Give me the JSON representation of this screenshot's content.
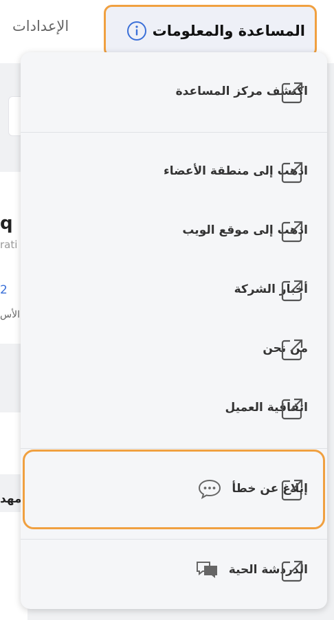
{
  "header": {
    "help_tab_label": "المساعدة والمعلومات",
    "settings_tab_label": "الإعدادات"
  },
  "background": {
    "frag_q": "q",
    "frag_rati": "rati",
    "frag_2": "2",
    "frag_al": "الأس",
    "frag_mh": "مهد"
  },
  "menu": {
    "items": [
      {
        "label": "اكتشف مركز المساعدة",
        "icon": "external-link-icon"
      },
      {
        "label": "اذهب إلى منطقة الأعضاء",
        "icon": "external-link-icon"
      },
      {
        "label": "اذهب إلى موقع الويب",
        "icon": "external-link-icon"
      },
      {
        "label": "أخبار الشركة",
        "icon": "external-link-icon"
      },
      {
        "label": "من نحن",
        "icon": "external-link-icon"
      },
      {
        "label": "اتفاقية العميل",
        "icon": "external-link-icon"
      },
      {
        "label": "إبلاغ عن خطأ",
        "icon": "external-link-icon",
        "lead_icon": "chat-bubble-icon"
      },
      {
        "label": "الدردشة الحية",
        "icon": "external-link-icon",
        "lead_icon": "live-chat-icon"
      }
    ]
  },
  "colors": {
    "highlight": "#f0a040",
    "menu_bg": "#f5f6f8",
    "info_icon": "#3a6fd8"
  }
}
